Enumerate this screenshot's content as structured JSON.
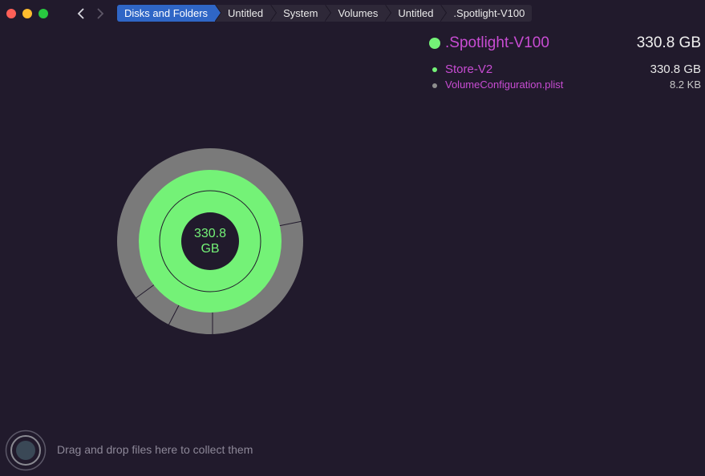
{
  "window": {
    "nav": {
      "back_icon": "chevron-left-icon",
      "forward_icon": "chevron-right-icon"
    }
  },
  "breadcrumb": [
    {
      "label": "Disks and Folders",
      "active": true
    },
    {
      "label": "Untitled"
    },
    {
      "label": "System"
    },
    {
      "label": "Volumes"
    },
    {
      "label": "Untitled"
    },
    {
      "label": ".Spotlight-V100"
    }
  ],
  "selection": {
    "name": ".Spotlight-V100",
    "size": "330.8 GB",
    "color": "#74f277",
    "children": [
      {
        "name": "Store-V2",
        "size": "330.8 GB",
        "color": "#74f277"
      },
      {
        "name": "VolumeConfiguration.plist",
        "size": "8.2  KB",
        "color": "#8e8e8e"
      }
    ]
  },
  "chart": {
    "center_value": "330.8",
    "center_unit": "GB",
    "colors": {
      "folder": "#74f277",
      "other": "#7a7a7a",
      "background": "#211a2c",
      "name_text": "#c84cd3"
    }
  },
  "drop_zone": {
    "text": "Drag and drop files here to collect them",
    "icon": "collect-target-icon"
  }
}
